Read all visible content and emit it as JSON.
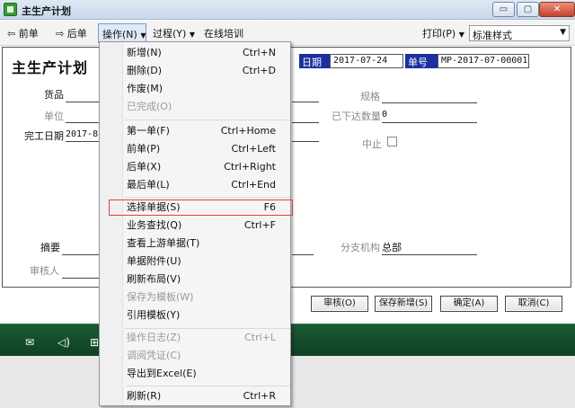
{
  "window": {
    "title": "主生产计划",
    "min": "▭",
    "max": "▢",
    "close": "✕"
  },
  "toolbar": {
    "prev": "前单",
    "next": "后单",
    "operation": "操作(N)",
    "process": "过程(Y)",
    "training": "在线培训",
    "print": "打印(P)",
    "style_value": "标准样式"
  },
  "form": {
    "title": "主生产计划",
    "date_label": "日期",
    "date_value": "2017-07-24",
    "number_label": "单号",
    "number_value": "MP-2017-07-00001",
    "goods": "货品",
    "unit": "单位",
    "finish_date": "完工日期",
    "finish_date_value": "2017-8-",
    "spec": "规格",
    "issued_qty": "已下达数量",
    "issued_qty_value": "0",
    "stop": "中止",
    "summary": "摘要",
    "branch": "分支机构",
    "branch_value": "总部",
    "reviewer": "审核人"
  },
  "buttons": {
    "review": "审核(O)",
    "save_new": "保存新增(S)",
    "ok": "确定(A)",
    "cancel": "取消(C)"
  },
  "bottombar": {
    "icons": [
      "mail-icon",
      "speaker-icon",
      "book-icon"
    ],
    "mail": "✉",
    "speaker": "◁)",
    "book": "⊞"
  },
  "menu": {
    "items": [
      {
        "label": "新增(N)",
        "key": "Ctrl+N",
        "disabled": false
      },
      {
        "label": "删除(D)",
        "key": "Ctrl+D",
        "disabled": false
      },
      {
        "label": "作废(M)",
        "key": "",
        "disabled": false
      },
      {
        "label": "已完成(O)",
        "key": "",
        "disabled": true
      },
      {
        "label": "第一单(F)",
        "key": "Ctrl+Home",
        "disabled": false
      },
      {
        "label": "前单(P)",
        "key": "Ctrl+Left",
        "disabled": false
      },
      {
        "label": "后单(X)",
        "key": "Ctrl+Right",
        "disabled": false
      },
      {
        "label": "最后单(L)",
        "key": "Ctrl+End",
        "disabled": false
      },
      {
        "label": "选择单据(S)",
        "key": "F6",
        "disabled": false
      },
      {
        "label": "业务查找(Q)",
        "key": "Ctrl+F",
        "disabled": false
      },
      {
        "label": "查看上游单据(T)",
        "key": "",
        "disabled": false
      },
      {
        "label": "单据附件(U)",
        "key": "",
        "disabled": false
      },
      {
        "label": "刷新布局(V)",
        "key": "",
        "disabled": false
      },
      {
        "label": "保存为模板(W)",
        "key": "",
        "disabled": true
      },
      {
        "label": "引用模板(Y)",
        "key": "",
        "disabled": false
      },
      {
        "label": "操作日志(Z)",
        "key": "Ctrl+L",
        "disabled": true
      },
      {
        "label": "调阅凭证(C)",
        "key": "",
        "disabled": true
      },
      {
        "label": "导出到Excel(E)",
        "key": "",
        "disabled": false
      },
      {
        "label": "刷新(R)",
        "key": "Ctrl+R",
        "disabled": false
      }
    ],
    "highlighted": "选择单据(S)"
  }
}
